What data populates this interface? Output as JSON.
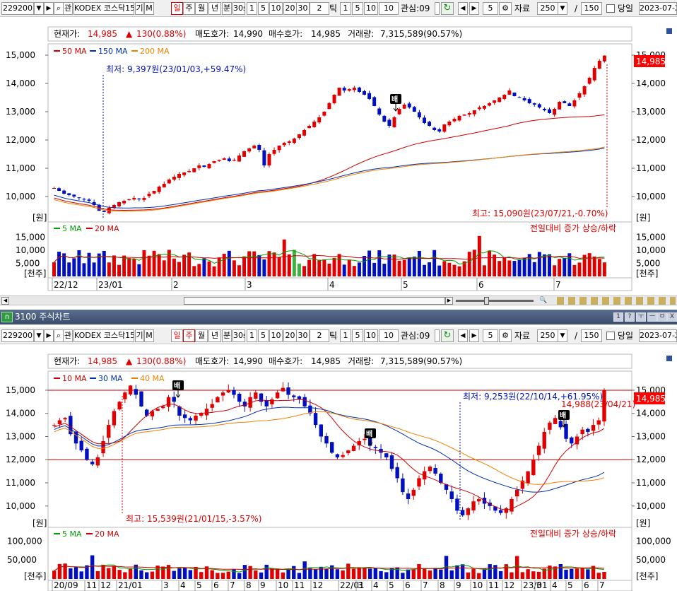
{
  "colors": {
    "up": "#e00000",
    "down": "#0010c0",
    "ma_short": "#d00000",
    "ma_mid": "#0030b0",
    "ma_long": "#f08000",
    "vol_ma5": "#00a000",
    "vol_ma20": "#d00000",
    "price_tag": "#ff0000",
    "green_vol": "#40b040"
  },
  "toolbar": {
    "code": "229200",
    "search_icon": "magnifier-icon",
    "gwan": "관",
    "name": "KODEX 코스닥15",
    "gi": "기",
    "m": "M",
    "periods": [
      "일",
      "주",
      "월",
      "년",
      "분",
      "30s"
    ],
    "nums1": [
      "1",
      "5",
      "10",
      "20",
      "30"
    ],
    "tick_value": "2",
    "tick_label": "틱",
    "nums2": [
      "1",
      "5",
      "10"
    ],
    "interest_label": "관심:09",
    "interest_value": "5",
    "data_label": "자료",
    "data_value": "250",
    "slash": "/",
    "data_total": "150",
    "today_label": "당일",
    "date": "2023-07-2"
  },
  "window": {
    "badge": "n",
    "title": "3100 주식차트",
    "buttons": [
      "1",
      "?",
      "ㅜ",
      "ㅡ",
      "ㅁ",
      "X"
    ]
  },
  "quote": {
    "current_label": "현재가:",
    "current": "14,985",
    "change_sign": "▲",
    "change": "130(0.88%)",
    "ask_label": "매도호가:",
    "ask": "14,990",
    "bid_label": "매수호가:",
    "bid": "14,985",
    "volume_label": "거래량:",
    "volume": "7,315,589(90.57%)"
  },
  "panel_top": {
    "ma_labels": [
      "50 MA",
      "150 MA",
      "200 MA"
    ],
    "price_ticks": [
      "15,000",
      "14,000",
      "13,000",
      "12,000",
      "11,000",
      "10,000"
    ],
    "unit_price": "[원]",
    "low_annot": "최저: 9,397원(23/01/03,+59.47%)",
    "high_annot": "최고: 15,090원(23/07/21,-0.70%)",
    "price_tag": "14,985",
    "vol_ma_labels": [
      "5 MA",
      "20 MA"
    ],
    "vol_ticks": [
      "15,000",
      "10,000",
      "5,000"
    ],
    "unit_vol": "[천주]",
    "vol_note": "전일대비 증가 상승/하락",
    "x_labels": [
      "22/12",
      "23/01",
      "2",
      "3",
      "4",
      "5",
      "6",
      "7"
    ],
    "sell_marker": "배"
  },
  "panel_bot": {
    "period_selected": "주",
    "ma_labels": [
      "10 MA",
      "30 MA",
      "40 MA"
    ],
    "price_ticks": [
      "15,000",
      "14,000",
      "13,000",
      "12,000",
      "11,000",
      "10,000"
    ],
    "unit_price": "[원]",
    "low_annot": "최저: 9,253원(22/10/14,+61.95%)",
    "high_annot": "최고: 15,539원(21/01/15,-3.57%)",
    "recent_annot": "14,988(23/04/21)",
    "price_tag": "14,985",
    "vol_ma_labels": [
      "5 MA",
      "20 MA"
    ],
    "vol_ticks": [
      "100,000",
      "50,000"
    ],
    "unit_vol": "[천주]",
    "vol_note": "전일대비 증가 상승/하락",
    "x_labels": [
      "20/09",
      "11",
      "12",
      "21/01",
      "3",
      "4",
      "5",
      "6",
      "7",
      "8",
      "9",
      "10",
      "11",
      "12",
      "22/01",
      "3",
      "4",
      "5",
      "6",
      "7",
      "8",
      "9",
      "10",
      "11",
      "12",
      "23/01",
      "3",
      "4",
      "5",
      "6",
      "7"
    ],
    "sell_marker": "배"
  },
  "chart_data": [
    {
      "type": "candlestick",
      "name": "daily",
      "ylim": [
        9200,
        15300
      ],
      "closes": [
        10300,
        10200,
        10100,
        10050,
        10000,
        9950,
        9900,
        9850,
        9700,
        9500,
        9450,
        9600,
        9700,
        9800,
        9850,
        9900,
        9950,
        9900,
        9950,
        10100,
        10200,
        10350,
        10450,
        10600,
        10700,
        10800,
        10850,
        10900,
        11000,
        11100,
        11050,
        11150,
        11250,
        11300,
        11350,
        11250,
        11300,
        11450,
        11600,
        11700,
        11800,
        11650,
        11100,
        11500,
        11650,
        11800,
        11900,
        11950,
        12050,
        12200,
        12350,
        12500,
        12650,
        12800,
        13000,
        13300,
        13600,
        13850,
        13750,
        13800,
        13850,
        13700,
        13600,
        13450,
        13200,
        12900,
        12650,
        12500,
        12800,
        13100,
        13250,
        13150,
        13000,
        12800,
        12600,
        12500,
        12350,
        12300,
        12550,
        12650,
        12750,
        12850,
        12900,
        12950,
        13050,
        13150,
        13200,
        13300,
        13400,
        13500,
        13600,
        13750,
        13550,
        13500,
        13400,
        13300,
        13250,
        13150,
        13050,
        12950,
        13100,
        13350,
        13300,
        13200,
        13400,
        13650,
        13900,
        14200,
        14550,
        14800,
        14985
      ],
      "volume_max": 15000
    },
    {
      "type": "candlestick",
      "name": "weekly",
      "ylim": [
        9200,
        15700
      ],
      "closes": [
        13500,
        13700,
        13800,
        13100,
        12700,
        12400,
        12000,
        11800,
        12100,
        12800,
        13500,
        14100,
        14500,
        14900,
        15200,
        14800,
        14300,
        13900,
        14100,
        14200,
        14300,
        14700,
        14500,
        13900,
        13800,
        13700,
        13900,
        14000,
        14200,
        14400,
        14700,
        14900,
        15000,
        14800,
        14500,
        14300,
        14700,
        14900,
        14500,
        14300,
        14600,
        14900,
        15100,
        14800,
        14700,
        14600,
        14300,
        14000,
        13500,
        13000,
        12700,
        12300,
        12100,
        12200,
        12400,
        12600,
        12800,
        12900,
        12600,
        12500,
        12300,
        12100,
        11600,
        11200,
        10600,
        10300,
        10700,
        11200,
        11500,
        11700,
        11400,
        11000,
        10700,
        10300,
        9800,
        9600,
        9900,
        10200,
        10300,
        10100,
        10000,
        9800,
        9700,
        9900,
        10300,
        10700,
        11100,
        11500,
        12000,
        12600,
        13200,
        13600,
        13800,
        13400,
        12900,
        12700,
        13000,
        13300,
        13200,
        13500,
        13700,
        14985
      ],
      "volume_max": 100000
    }
  ]
}
